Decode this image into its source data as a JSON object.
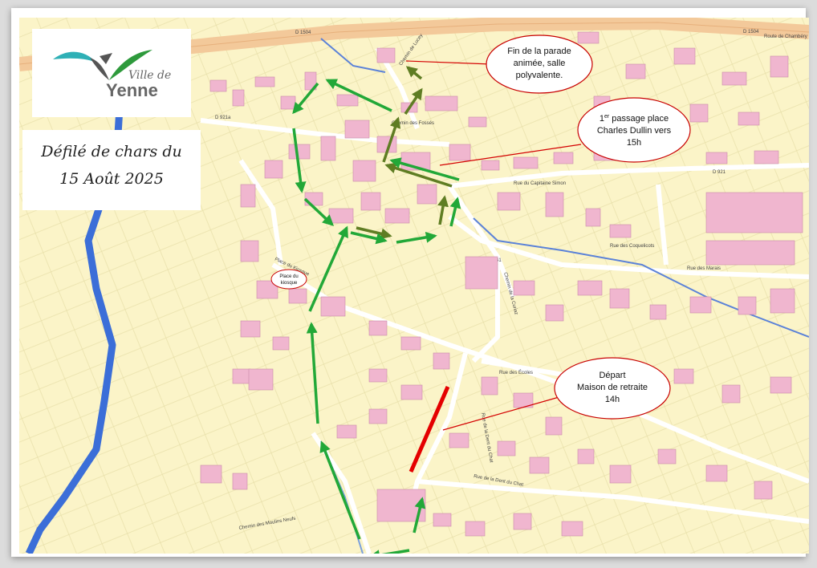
{
  "logo": {
    "line1": "Ville de",
    "line2": "Yenne"
  },
  "title": {
    "line1": "Défilé de chars du",
    "line2": "15 Août 2025"
  },
  "callouts": {
    "fin": {
      "l1": "Fin de la parade",
      "l2": "animée, salle",
      "l3": "polyvalente."
    },
    "passage": {
      "sup": "er",
      "l1a": "1",
      "l1b": " passage place",
      "l2": "Charles Dullin vers",
      "l3": "15h"
    },
    "depart": {
      "l1": "Départ",
      "l2": "Maison de retraite",
      "l3": "14h"
    },
    "kiosque": {
      "l1": "Place du",
      "l2": "kiosque"
    }
  },
  "roads": {
    "d1504a": "D 1504",
    "d1504b": "D 1504",
    "chambery": "Route de Chambéry",
    "capitaine": "Rue du Capitaine Simon",
    "d921": "D 921",
    "d921b": "D 921a",
    "d41": "D 41",
    "curiaz": "Chemin de la Curiaz",
    "ecoles": "Rue des Écoles",
    "dentchat": "Rue de la Dent du Chat",
    "dentchat2": "Rue de la Dent du Chat",
    "coquelicots": "Rue des Coquelicots",
    "kiosque_rd": "Place du Kiosque",
    "marais": "Rue des Marais",
    "moulins": "Chemin des Moulins Neufs",
    "lucey": "Chemin de Lucey",
    "fosses": "Chemin des Fossés"
  },
  "colors": {
    "route_green": "#22a838",
    "route_olive": "#5f7d23",
    "depart_red": "#e40000",
    "river": "#3b6ed8",
    "map_bg": "#fbf4c8",
    "building": "#f0b6cf"
  }
}
